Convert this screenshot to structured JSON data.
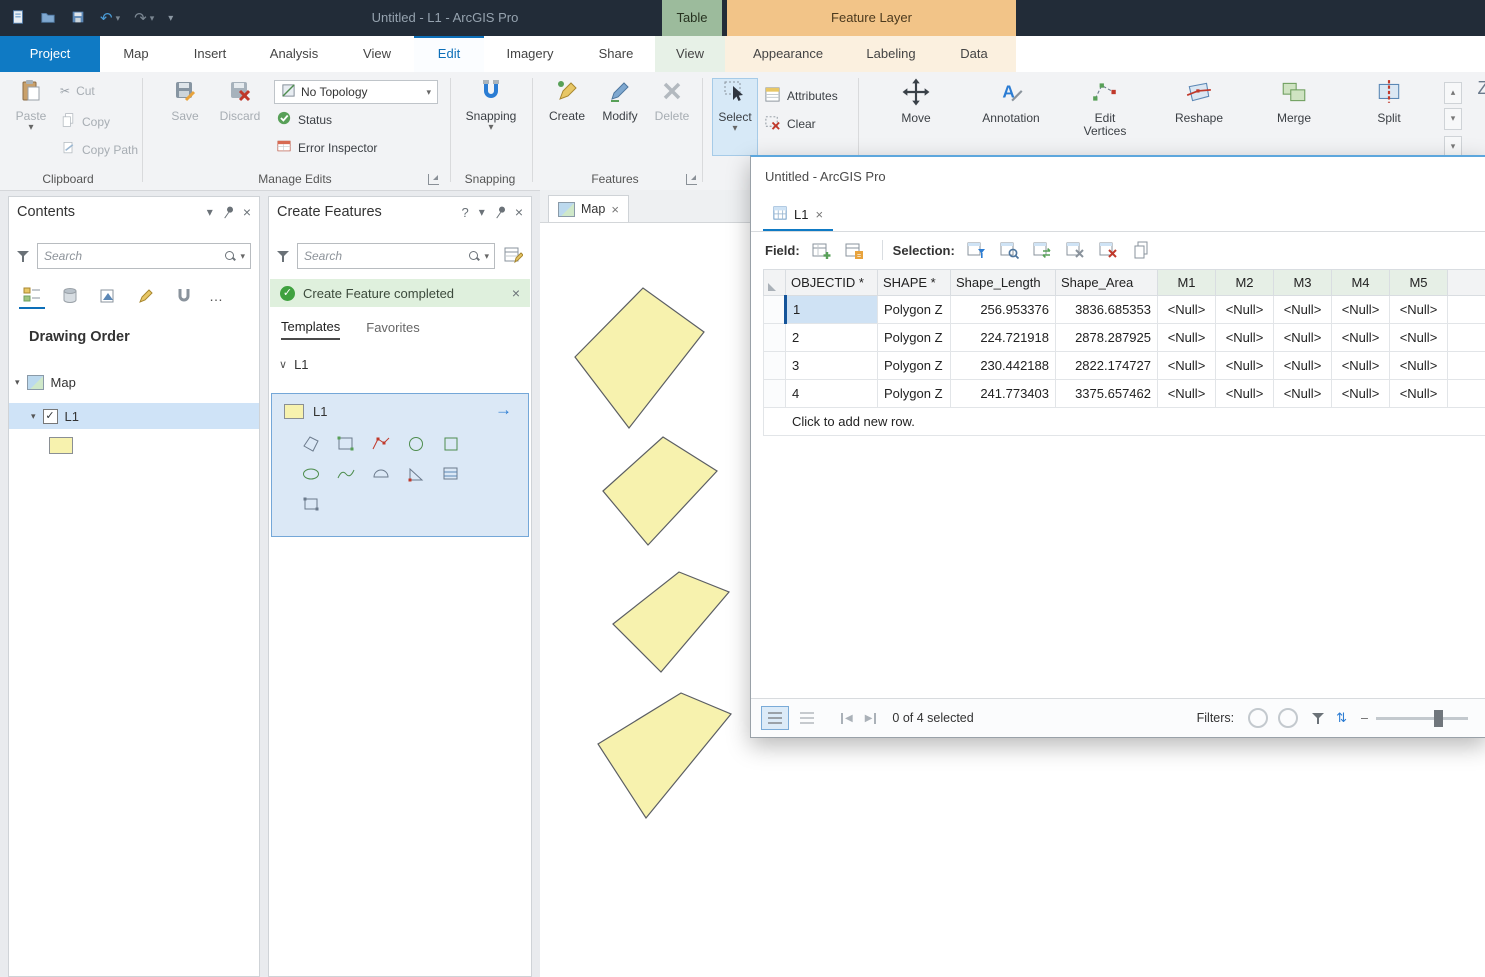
{
  "colors": {
    "accent_blue": "#0f7ac4",
    "titlebar": "#222c38",
    "contextual_table_green": "#9cbb9c",
    "contextual_feature_layer_orange": "#f2c488",
    "selection_fill": "#cfe2f4",
    "selection_bar": "#15559a",
    "polygon_fill": "#f7f2ae",
    "banner_green": "#dff0dd",
    "template_selected": "#dbe8f6"
  },
  "icons": {
    "caret_down": "▾",
    "caret_up": "▴",
    "close": "×",
    "check": "✓",
    "help": "?",
    "ellipsis": "…",
    "arrow_right": "→",
    "undo": "↶",
    "redo": "↷",
    "prev": "◀",
    "next": "▶",
    "minus": "–",
    "swap": "⇅",
    "scissors": "✂",
    "chevron": "∨",
    "clipped_glyph": "Z"
  },
  "titlebar": {
    "title": "Untitled - L1 - ArcGIS Pro",
    "table_group": "Table",
    "feature_layer_group": "Feature Layer"
  },
  "tabs": {
    "main": [
      "Project",
      "Map",
      "Insert",
      "Analysis",
      "View",
      "Edit",
      "Imagery",
      "Share"
    ],
    "table_ctx": "View",
    "fl_ctx": [
      "Appearance",
      "Labeling",
      "Data"
    ]
  },
  "ribbon": {
    "groups": {
      "clipboard": "Clipboard",
      "manage_edits": "Manage Edits",
      "snapping": "Snapping",
      "features": "Features"
    },
    "buttons": {
      "paste": "Paste",
      "cut": "Cut",
      "copy": "Copy",
      "copy_path": "Copy Path",
      "save": "Save",
      "discard": "Discard",
      "no_topology": "No Topology",
      "status": "Status",
      "error_inspector": "Error Inspector",
      "snapping": "Snapping",
      "create": "Create",
      "modify": "Modify",
      "delete": "Delete",
      "select": "Select",
      "attributes": "Attributes",
      "clear": "Clear",
      "move": "Move",
      "annotation": "Annotation",
      "edit_vertices": "Edit Vertices",
      "reshape": "Reshape",
      "merge": "Merge",
      "split": "Split"
    }
  },
  "contents": {
    "title": "Contents",
    "search_placeholder": "Search",
    "drawing_order": "Drawing Order",
    "map_layer": "Map",
    "l1_layer": "L1"
  },
  "create_features": {
    "title": "Create Features",
    "search_placeholder": "Search",
    "banner_text": "Create Feature completed",
    "templates_tab": "Templates",
    "favorites_tab": "Favorites",
    "group_l1": "L1",
    "template_l1": "L1"
  },
  "map_view": {
    "tab": "Map"
  },
  "table_window": {
    "title": "Untitled - ArcGIS Pro",
    "tab": "L1",
    "field_label": "Field:",
    "selection_label": "Selection:",
    "columns": [
      "OBJECTID *",
      "SHAPE *",
      "Shape_Length",
      "Shape_Area",
      "M1",
      "M2",
      "M3",
      "M4",
      "M5"
    ],
    "rows": [
      [
        "1",
        "Polygon Z",
        "256.953376",
        "3836.685353",
        "<Null>",
        "<Null>",
        "<Null>",
        "<Null>",
        "<Null>"
      ],
      [
        "2",
        "Polygon Z",
        "224.721918",
        "2878.287925",
        "<Null>",
        "<Null>",
        "<Null>",
        "<Null>",
        "<Null>"
      ],
      [
        "3",
        "Polygon Z",
        "230.442188",
        "2822.174727",
        "<Null>",
        "<Null>",
        "<Null>",
        "<Null>",
        "<Null>"
      ],
      [
        "4",
        "Polygon Z",
        "241.773403",
        "3375.657462",
        "<Null>",
        "<Null>",
        "<Null>",
        "<Null>",
        "<Null>"
      ]
    ],
    "add_row": "Click to add new row.",
    "status": {
      "selected": "0 of 4 selected",
      "filters": "Filters:"
    }
  }
}
